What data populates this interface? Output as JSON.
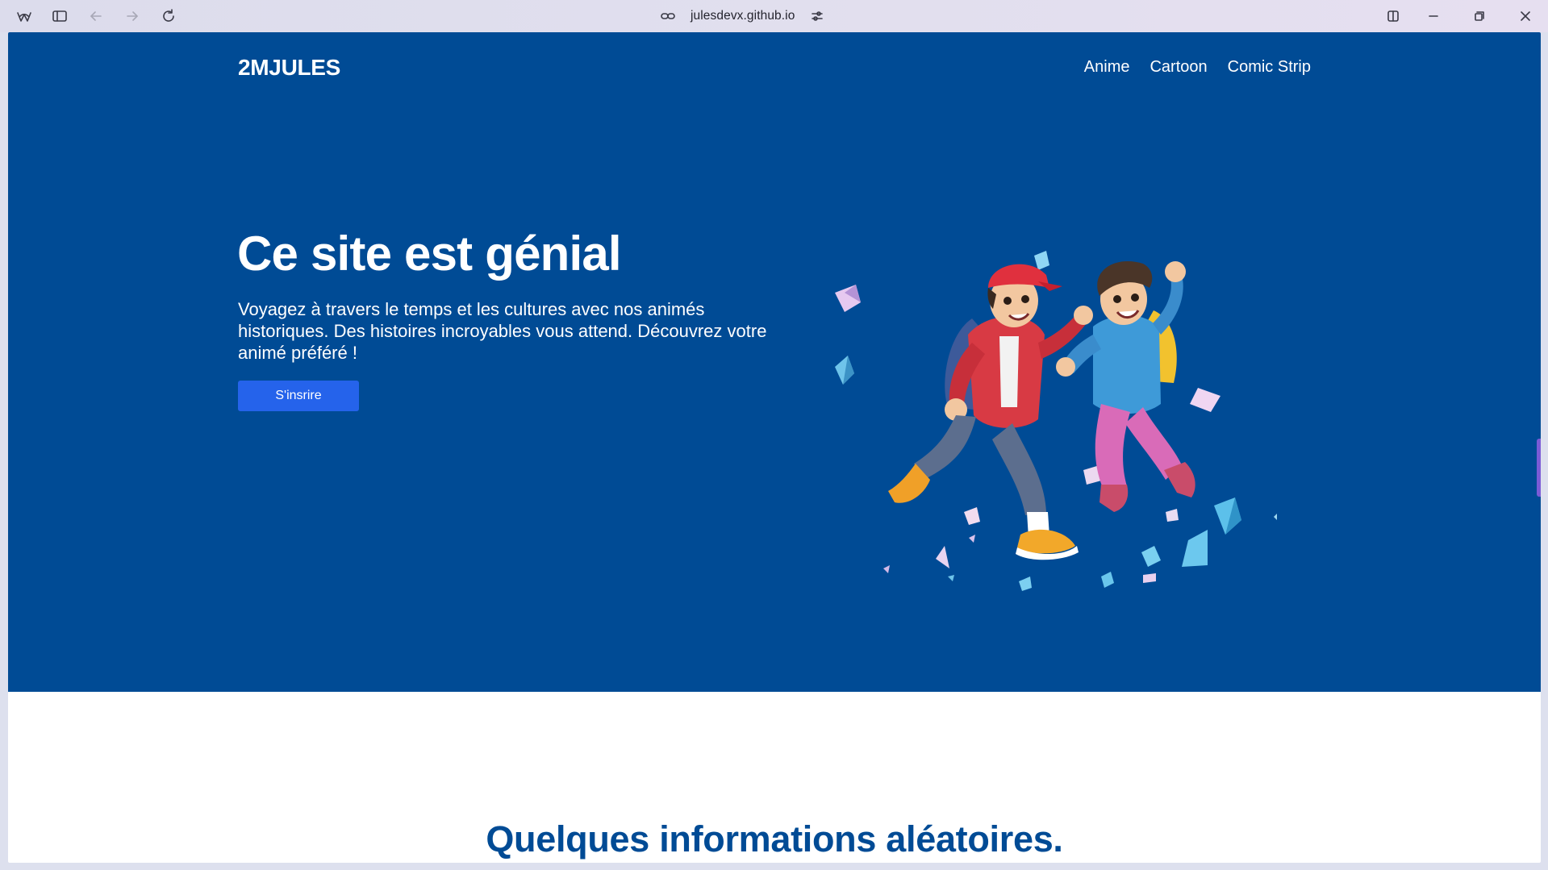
{
  "browser": {
    "url": "julesdevx.github.io",
    "icons": [
      "browser-logo-icon",
      "sidebar-toggle-icon",
      "back-arrow-icon",
      "forward-arrow-icon",
      "reload-icon",
      "link-icon",
      "site-settings-icon",
      "split-view-icon",
      "minimize-icon",
      "restore-icon",
      "close-icon"
    ]
  },
  "site": {
    "brand": "2MJULES",
    "nav": [
      {
        "label": "Anime"
      },
      {
        "label": "Cartoon"
      },
      {
        "label": "Comic Strip"
      }
    ]
  },
  "hero": {
    "title": "Ce site est génial",
    "text": "Voyagez à travers le temps et les cultures avec nos animés historiques. Des histoires incroyables vous attend. Découvrez votre animé préféré !",
    "cta": "S'insrire"
  },
  "section": {
    "title": "Quelques informations aléatoires."
  },
  "colors": {
    "hero_bg": "#004b95",
    "cta_bg": "#2563eb",
    "section_title": "#004b95",
    "chrome_bg": "#dedcee"
  }
}
